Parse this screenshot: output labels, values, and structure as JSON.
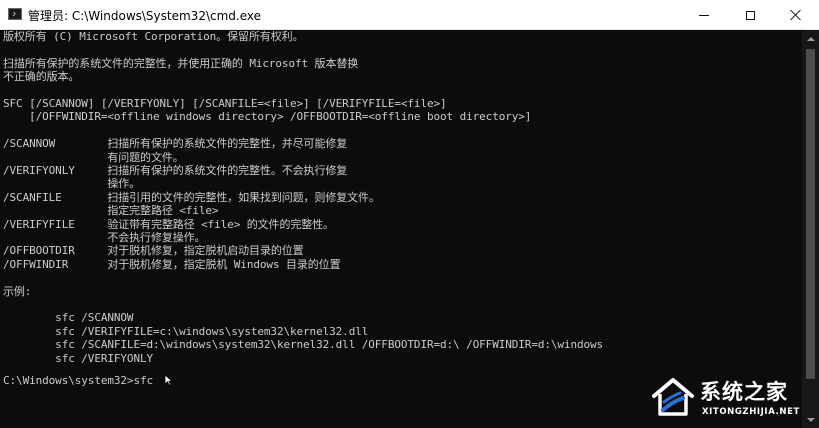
{
  "window": {
    "title": "管理员: C:\\Windows\\System32\\cmd.exe"
  },
  "console": {
    "lines": [
      "版权所有 (C) Microsoft Corporation。保留所有权利。",
      "",
      "扫描所有保护的系统文件的完整性，并使用正确的 Microsoft 版本替换",
      "不正确的版本。",
      "",
      "SFC [/SCANNOW] [/VERIFYONLY] [/SCANFILE=<file>] [/VERIFYFILE=<file>]",
      "    [/OFFWINDIR=<offline windows directory> /OFFBOOTDIR=<offline boot directory>]",
      "",
      "/SCANNOW        扫描所有保护的系统文件的完整性，并尽可能修复",
      "                有问题的文件。",
      "/VERIFYONLY     扫描所有保护的系统文件的完整性。不会执行修复",
      "                操作。",
      "/SCANFILE       扫描引用的文件的完整性，如果找到问题，则修复文件。",
      "                指定完整路径 <file>",
      "/VERIFYFILE     验证带有完整路径 <file> 的文件的完整性。",
      "                不会执行修复操作。",
      "/OFFBOOTDIR     对于脱机修复，指定脱机启动目录的位置",
      "/OFFWINDIR      对于脱机修复，指定脱机 Windows 目录的位置",
      "",
      "示例:",
      "",
      "        sfc /SCANNOW",
      "        sfc /VERIFYFILE=c:\\windows\\system32\\kernel32.dll",
      "        sfc /SCANFILE=d:\\windows\\system32\\kernel32.dll /OFFBOOTDIR=d:\\ /OFFWINDIR=d:\\windows",
      "        sfc /VERIFYONLY",
      ""
    ],
    "prompt": "C:\\Windows\\system32>sfc"
  },
  "watermark": {
    "title": "系统之家",
    "subtitle": "XITONGZHIJIA.NET"
  },
  "colors": {
    "console_bg": "#0c0c0c",
    "console_text": "#cccccc",
    "titlebar_bg": "#ffffff",
    "watermark_accent": "#2a6fd6"
  }
}
